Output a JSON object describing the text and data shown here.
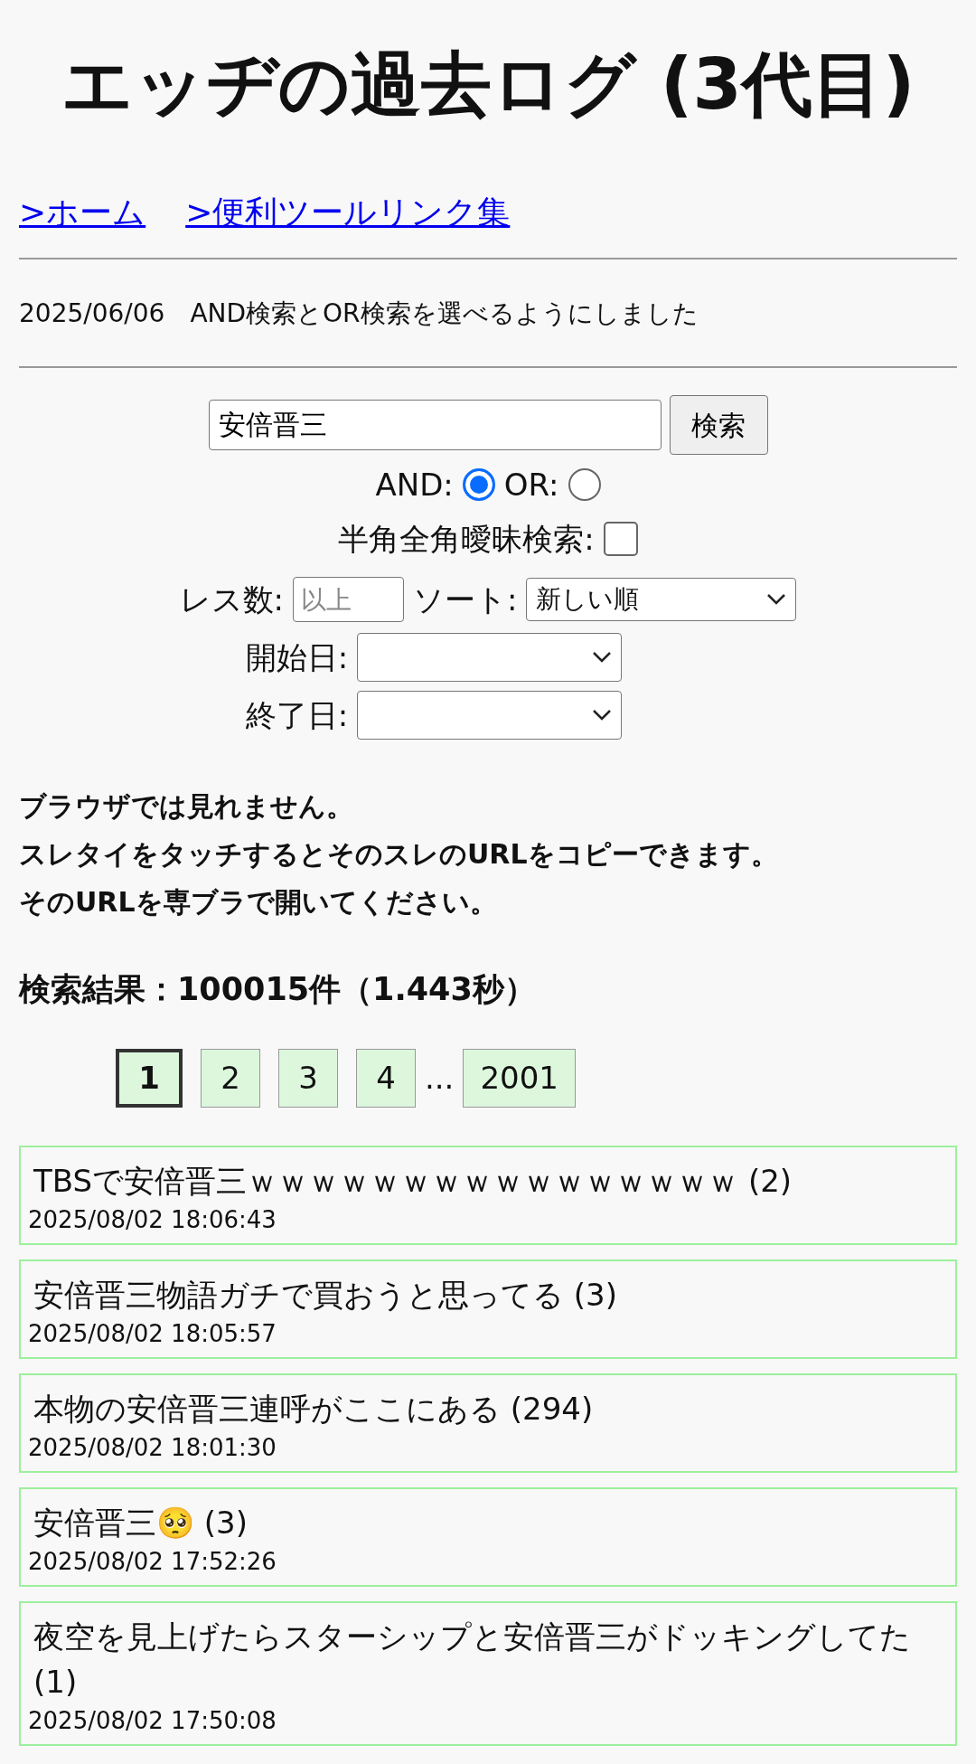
{
  "title": "エッヂの過去ログ (3代目)",
  "nav_links": [
    {
      "label": ">ホーム"
    },
    {
      "label": ">便利ツールリンク集"
    }
  ],
  "notice": "2025/06/06　AND検索とOR検索を選べるようにしました",
  "search": {
    "value": "安倍晋三",
    "button": "検索",
    "mode_options": [
      {
        "label": "AND:",
        "selected": true
      },
      {
        "label": "OR:",
        "selected": false
      }
    ],
    "fuzzy": {
      "label": "半角全角曖昧検索:",
      "checked": false
    },
    "res_count": {
      "label": "レス数:",
      "placeholder": "以上"
    },
    "sort": {
      "label": "ソート:",
      "value": "新しい順"
    },
    "start_date": {
      "label": "開始日:"
    },
    "end_date": {
      "label": "終了日:"
    }
  },
  "instructions": [
    "ブラウザでは見れません。",
    "スレタイをタッチするとそのスレのURLをコピーできます。",
    "そのURLを専ブラで開いてください。"
  ],
  "result_summary": "検索結果：100015件（1.443秒）",
  "pagination": [
    {
      "kind": "page",
      "label": "1",
      "selected": true
    },
    {
      "kind": "page",
      "label": "2",
      "selected": false
    },
    {
      "kind": "page",
      "label": "3",
      "selected": false
    },
    {
      "kind": "page",
      "label": "4",
      "selected": false
    },
    {
      "kind": "ellipsis",
      "label": "..."
    },
    {
      "kind": "page",
      "label": "2001",
      "selected": false
    }
  ],
  "threads": [
    {
      "title": "TBSで安倍晋三ｗｗｗｗｗｗｗｗｗｗｗｗｗｗｗｗ (2)",
      "date": "2025/08/02 18:06:43"
    },
    {
      "title": "安倍晋三物語ガチで買おうと思ってる (3)",
      "date": "2025/08/02 18:05:57"
    },
    {
      "title": "本物の安倍晋三連呼がここにある (294)",
      "date": "2025/08/02 18:01:30"
    },
    {
      "title": "安倍晋三🥺 (3)",
      "date": "2025/08/02 17:52:26"
    },
    {
      "title": "夜空を見上げたらスターシップと安倍晋三がドッキングしてた (1)",
      "date": "2025/08/02 17:50:08"
    }
  ]
}
